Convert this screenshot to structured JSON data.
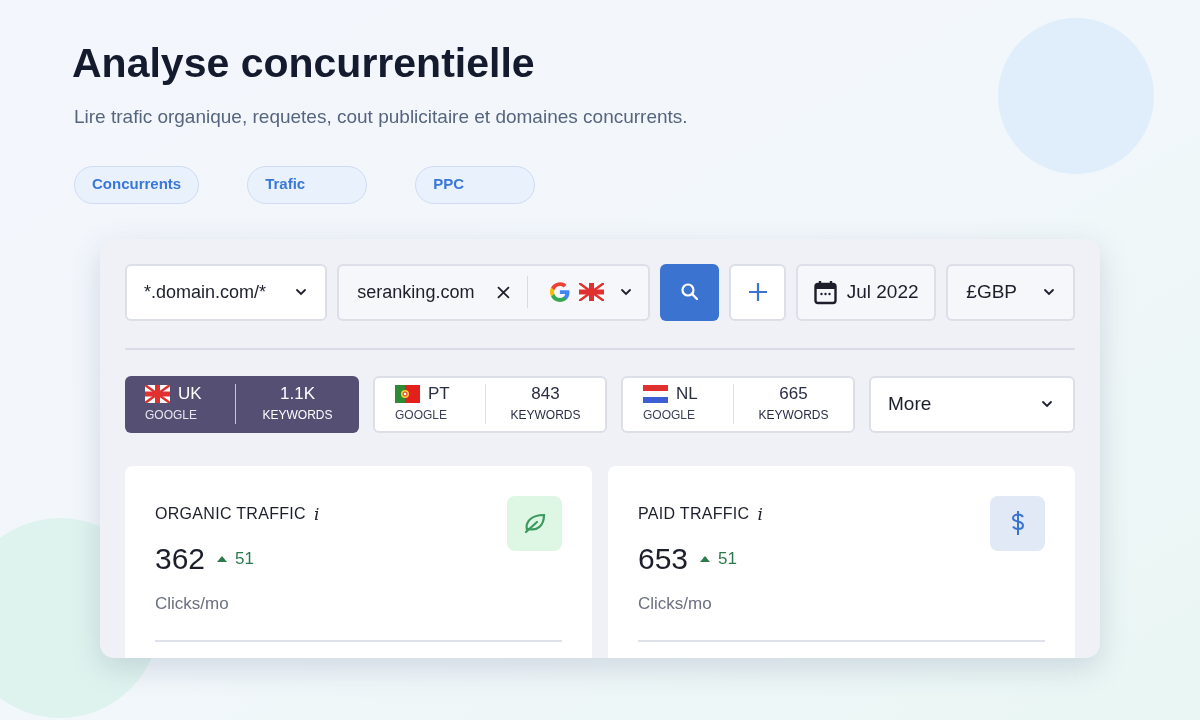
{
  "header": {
    "title": "Analyse concurrentielle",
    "subtitle": "Lire trafic organique, requetes, cout publicitaire et domaines concurrents."
  },
  "tags": [
    "Concurrents",
    "Trafic",
    "PPC"
  ],
  "toolbar": {
    "scope": "*.domain.com/*",
    "domain": "seranking.com",
    "date": "Jul 2022",
    "currency": "£GBP"
  },
  "regions": [
    {
      "kind": "uk",
      "code": "UK",
      "engine": "GOOGLE",
      "count": "1.1K",
      "unit": "KEYWORDS",
      "selected": true
    },
    {
      "kind": "pt",
      "code": "PT",
      "engine": "GOOGLE",
      "count": "843",
      "unit": "KEYWORDS",
      "selected": false
    },
    {
      "kind": "nl",
      "code": "NL",
      "engine": "GOOGLE",
      "count": "665",
      "unit": "KEYWORDS",
      "selected": false
    }
  ],
  "more_button": "More",
  "cards": [
    {
      "kind": "leaf",
      "title": "ORGANIC TRAFFIC",
      "info": "i",
      "value": "362",
      "delta": "51",
      "unit": "Clicks/mo"
    },
    {
      "kind": "dollar",
      "title": "PAID TRAFFIC",
      "info": "i",
      "value": "653",
      "delta": "51",
      "unit": "Clicks/mo"
    }
  ]
}
